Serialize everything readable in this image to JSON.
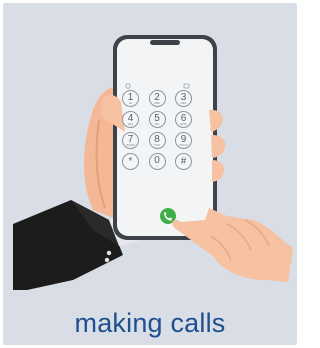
{
  "caption": "making calls",
  "keypad": [
    [
      {
        "d": "1",
        "s": "oo"
      },
      {
        "d": "2",
        "s": "ABC"
      },
      {
        "d": "3",
        "s": "DEF"
      }
    ],
    [
      {
        "d": "4",
        "s": "GHI"
      },
      {
        "d": "5",
        "s": "JKL"
      },
      {
        "d": "6",
        "s": "MNO"
      }
    ],
    [
      {
        "d": "7",
        "s": "PQRS"
      },
      {
        "d": "8",
        "s": "TUV"
      },
      {
        "d": "9",
        "s": "WXYZ"
      }
    ],
    [
      {
        "d": "*",
        "s": ""
      },
      {
        "d": "0",
        "s": "+"
      },
      {
        "d": "#",
        "s": ""
      }
    ]
  ],
  "colors": {
    "background": "#d9dde6",
    "caption": "#1e4f8f",
    "call_button": "#3fae49",
    "skin": "#f7c2a2",
    "sleeve": "#1c1c1c"
  }
}
